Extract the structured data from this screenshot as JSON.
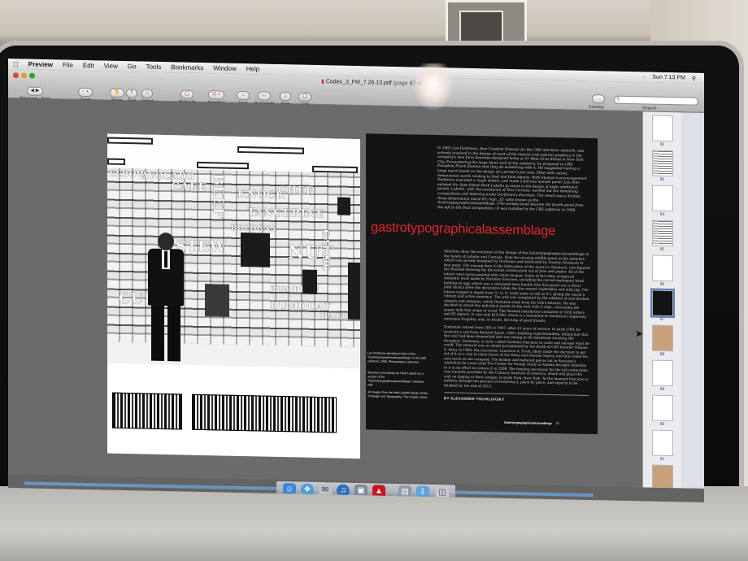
{
  "menubar": {
    "apple_icon": "apple-icon",
    "items": [
      "Preview",
      "File",
      "Edit",
      "View",
      "Go",
      "Tools",
      "Bookmarks",
      "Window",
      "Help"
    ],
    "clock": "Sun 7:13 PM"
  },
  "window": {
    "title": "Codex_3_FM_7.26.13.pdf",
    "page_info": "(page 87 of 117)"
  },
  "toolbar": {
    "previous_next": "Previous · Next",
    "zoom": "Zoom",
    "move": "Move",
    "text": "Text",
    "select": "Select",
    "markup": "Mark Up",
    "annotate": "Annotate",
    "oval": "Oval",
    "rectangle": "Rectangle",
    "note": "Note",
    "link": "Link",
    "sidebar": "Sidebar",
    "search_label": "Search",
    "search_placeholder": ""
  },
  "left_page": {
    "mural_words": [
      "ELBOW",
      "AVOCADO",
      "CAFE",
      "BEEF",
      "KNOCK",
      "STEW",
      "TANGERINE",
      "BOLOGNA",
      "NUT",
      "GARLIC",
      "CUP",
      "BAGELS",
      "PUMPKIN",
      "RUMOUAT",
      "CHEF"
    ],
    "caption_1": "Lou Dorfsman standing in front of the \"Gastrotypographicalassemblage\" in the CBS cafeteria, 1966. Photographer unknown.",
    "caption_2": "Sketches and stamps by Herb Lubalin for a section of the \"Gastrotypographicalassemblage\" cafeteria wall.",
    "caption_3": "All images from the Herb Lubalin Study Center of Design and Typography, The Cooper Union."
  },
  "right_page": {
    "intro": "In 1965 Lou Dorfsman, then Creative Director for the CBS television network, was actively involved in the design of most of the interior and exterior graphics in the company's new Eero Saarinen-designed home at 51 West 52nd Street in New York City. Encountering the large blank wall of the cafeteria, he proposed to CBS President Frank Stanton that they do something with it. He suggested making a large mural based on the design of a printer's job case, filled with cutout, dimensional words relating to food and food objects. With Stanton's encouragement Dorfsman executed a rough sketch, and made a full-size sample panel. Lou then enlisted his close friend Herb Lubalin to assist in the design of eight additional panels. Lubalin, with the assistance of Tom Carnase, worked out the remaining compositions and lettering under Dorfsman's direction. The result was a 40-foot, three-dimensional mural 8½ high, 35' wide known as the Gastrotypographicalassemblage. (The sample panel became the fourth panel from the left in the final composition.) It was installed in the CBS cafeteria in 1966.",
    "headline": "gastrotypographicalassemblage",
    "body_1": "Sketches show the evolution of the design of the Gastrotypographicalassemblage in the hands of Lubalin and Carnase. Note the missing middle panel in the sketches, which was already designed by Dorfsman and fabricated by Stanley Glaubach at that point. The unsung hero in the fabrication of the mural is Glaubach, who figured the finished lettering for the entire construction out of pine and poplar. All of the letters were spray-painted with white lacquer. Some of the other sculptural elements were made by Nicholas Fasciano, including the carved mahogany hand holding an egg, which was a simulated door handle (the first panel was a door). John Alcorn drew the decorative labels for the canned vegetables and milk jug. The letters ranged in depth from ¾\" to 4\" (with some as tall as 6\"), giving the mural a vibrant and active presence. The wall was completed by the addition of real kitchen utensils and antiques, which Dorfsman stole from his wife's kitchen. He also decided to attach the individual panels to the wall with Z-clips, concealing the seams with thin strips of wood. The finished installation consisted of 1650 letters and 85 objects. It cost only $19,000, which is a testament to Dorfsman's ingenuity, notorious frugality, and, no doubt, the help of good friends.",
    "body_2": "Dorfsman retired from CBS in 1987, after 41 years of service. In early 1991 he received a call from Richard Sporn, CBS's building superintendent, telling him that the wall had been dismantled and was sitting in the basement awaiting the dumpster. Dorfsman, in turn, called Nicholas Fasciano to come and salvage what he could. The removal was no doubt precipitated by the death of CBS founder William S. Paley in 1990. His successor, Laurence A. Tisch, likely made the decision to get rid of it as a way to clean house of the Paley and Stanton legacy, and thus make his own mark on the company. The broken and battered pieces sat in Fasciano's workshop for years until The Center for Design Study in Atlanta brought attention to it in an effort to restore it in 2008. The funding necessary for the full restoration was recently provided by the Culinary Institute of America, which will place the wall on display at their campus in Hyde Park, New York. At the moment Fasciano is halfway through the process of restoring it, piece by piece, and expects to be finished by the end of 2013.",
    "byline": "BY ALEXANDER TOCHILOVSKY",
    "footer_title": "Gastrotypographicalassemblage",
    "footer_page": "87"
  },
  "sidebar": {
    "thumbs": [
      {
        "num": "82",
        "style": "light"
      },
      {
        "num": "83",
        "style": "pattern"
      },
      {
        "num": "84",
        "style": "light"
      },
      {
        "num": "85",
        "style": "pattern"
      },
      {
        "num": "86",
        "style": "light"
      },
      {
        "num": "87",
        "style": "dark"
      },
      {
        "num": "88",
        "style": "tan"
      },
      {
        "num": "89",
        "style": "light"
      },
      {
        "num": "90",
        "style": "light"
      },
      {
        "num": "91",
        "style": "light"
      },
      {
        "num": "92",
        "style": "tan"
      }
    ]
  },
  "dock": {
    "icons": [
      "finder-icon",
      "safari-icon",
      "mail-icon",
      "itunes-icon",
      "photo-icon",
      "acrobat-icon",
      "preview-icon",
      "downloads-icon",
      "trash-icon"
    ]
  },
  "colors": {
    "headline_red": "#e0262b",
    "selection_blue": "#5b7fbf"
  }
}
